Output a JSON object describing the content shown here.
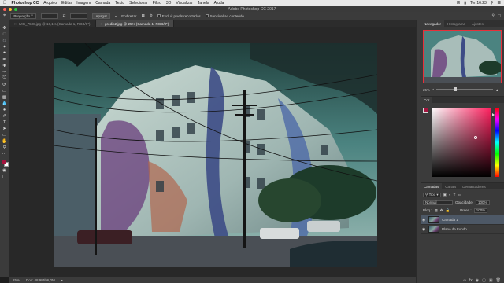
{
  "menubar": {
    "app_name": "Photoshop CC",
    "items": [
      "Arquivo",
      "Editar",
      "Imagem",
      "Camada",
      "Texto",
      "Selecionar",
      "Filtro",
      "3D",
      "Visualizar",
      "Janela",
      "Ajuda"
    ],
    "clock": "Ter 16:23"
  },
  "window": {
    "title": "Adobe Photoshop CC 2017"
  },
  "options": {
    "mode_label": "Proporção",
    "straighten_label": "Apagar",
    "button_label": "Endireitar",
    "delete_cropped_label": "Excluir pixels recortados",
    "content_aware_label": "Sensível ao conteúdo"
  },
  "tabs": [
    {
      "label": "IMG_7508.jpg @ 16,1% (Camada 1, RGB/8*)",
      "active": false
    },
    {
      "label": "predio2.jpg @ 25% (Camada 1, RGB/8*)",
      "active": true
    }
  ],
  "status": {
    "zoom": "25%",
    "doc_info": "Doc: 48,9M/96,0M"
  },
  "navigator": {
    "tabs": [
      "Navegador",
      "Histograma",
      "Ajustes"
    ],
    "zoom": "25%"
  },
  "color": {
    "tabs": [
      "Cor"
    ],
    "foreground": "#a4143e"
  },
  "layers": {
    "tabs": [
      "Camadas",
      "Canais",
      "Demarcadores"
    ],
    "filter_label": "Tipo",
    "blend_mode": "Normal",
    "opacity_label": "Opacidade:",
    "opacity_value": "100%",
    "lock_label": "Bloq.:",
    "fill_label": "Preen.:",
    "fill_value": "100%",
    "items": [
      {
        "name": "Camada 1",
        "active": true
      },
      {
        "name": "Plano de Fundo",
        "active": false
      }
    ]
  },
  "colors": {
    "accent_red": "#e8303a",
    "foreground_swatch": "#a4143e",
    "background_swatch": "#ffffff"
  }
}
